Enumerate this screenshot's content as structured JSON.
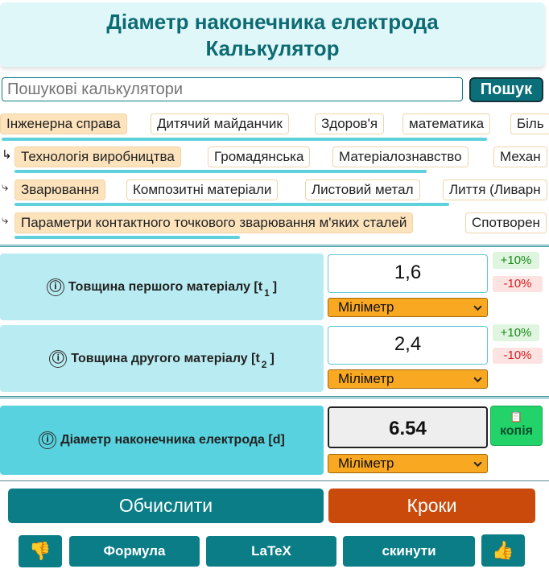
{
  "header": {
    "title_line1": "Діаметр наконечника електрода",
    "title_line2": "Калькулятор"
  },
  "search": {
    "placeholder": "Пошукові калькулятори",
    "button": "Пошук"
  },
  "categories": {
    "row1": [
      "Інженерна справа",
      "Дитячий майданчик",
      "Здоров'я",
      "математика",
      "Біль"
    ],
    "row2": [
      "Технологія виробництва",
      "Громадянська",
      "Матеріалознавство",
      "Механ"
    ],
    "row3": [
      "Зварювання",
      "Композитні матеріали",
      "Листовий метал",
      "Лиття (Ливарн"
    ],
    "row4": [
      "Параметри контактного точкового зварювання м'яких сталей",
      "Спотворен"
    ],
    "arrows": [
      "↳",
      "⤷",
      "⤷"
    ]
  },
  "inputs": [
    {
      "label": "Товщина першого матеріалу [t",
      "sub": "1",
      "close": "]",
      "value": "1,6",
      "unit": "Міліметр",
      "plus": "+10%",
      "minus": "-10%"
    },
    {
      "label": "Товщина другого матеріалу [t",
      "sub": "2",
      "close": "]",
      "value": "2,4",
      "unit": "Міліметр",
      "plus": "+10%",
      "minus": "-10%"
    }
  ],
  "result": {
    "label": "Діаметр наконечника електрода [d]",
    "value": "6.54",
    "unit": "Міліметр",
    "copy": "копія"
  },
  "actions": {
    "calculate": "Обчислити",
    "steps": "Кроки",
    "formula": "Формула",
    "latex": "LaTeX",
    "reset": "скинути"
  },
  "icons": {
    "info": "ⓘ",
    "copy": "📋",
    "dislike": "👎",
    "like": "👍"
  },
  "colors": {
    "accent": "#0b7d86",
    "steps": "#c94a0a",
    "unit": "#f9a822",
    "copy": "#22d36a"
  }
}
